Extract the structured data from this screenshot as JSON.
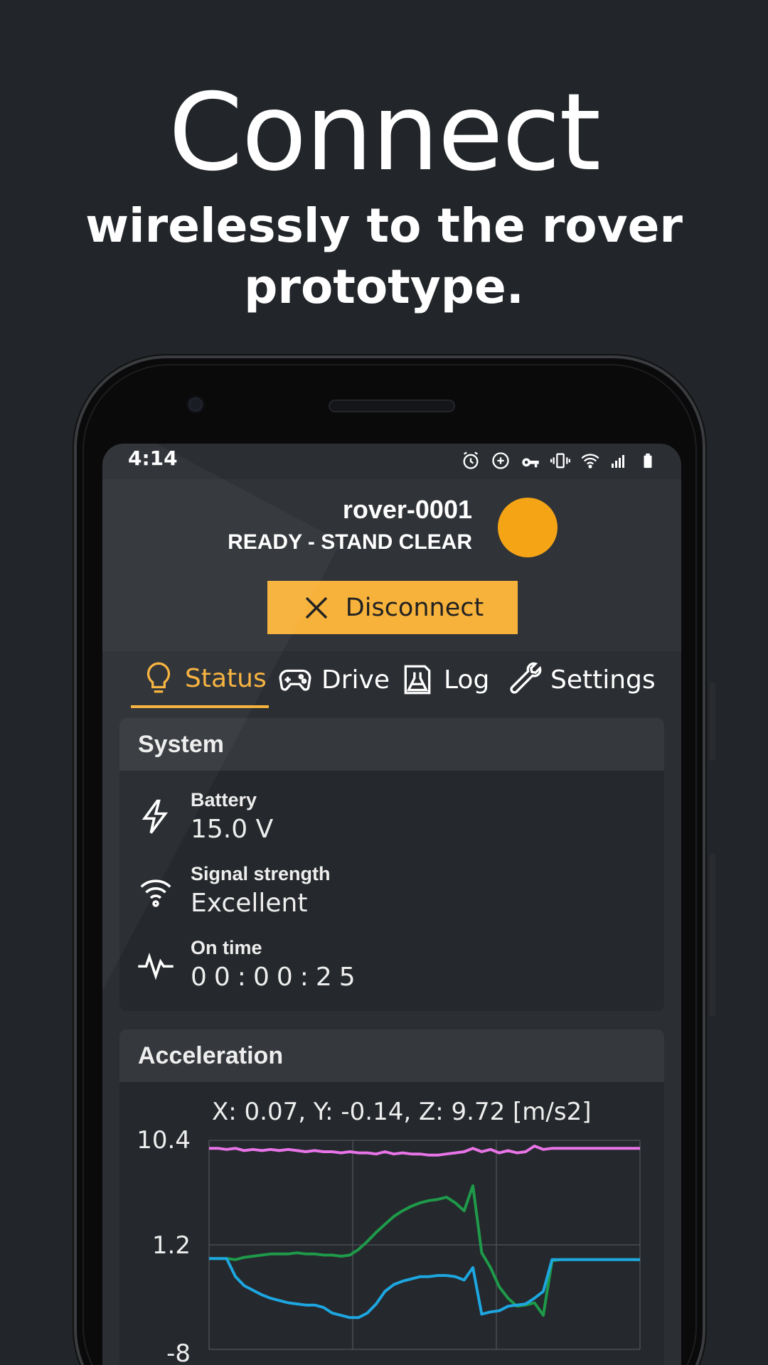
{
  "promo": {
    "title": "Connect",
    "subtitle_line1": "wirelessly to the rover",
    "subtitle_line2": "prototype."
  },
  "statusbar": {
    "time": "4:14",
    "icons": [
      "alarm-icon",
      "data-saver-icon",
      "vpn-key-icon",
      "vibrate-icon",
      "wifi-icon",
      "cell-signal-icon",
      "battery-icon"
    ]
  },
  "rover": {
    "name": "rover-0001",
    "state": "READY - STAND CLEAR",
    "indicator_color": "#f5a416"
  },
  "disconnect": {
    "label": "Disconnect",
    "icon": "close-icon",
    "color": "#f7b23b"
  },
  "tabs": [
    {
      "label": "Status",
      "icon": "lightbulb-icon",
      "active": true
    },
    {
      "label": "Drive",
      "icon": "gamepad-icon",
      "active": false
    },
    {
      "label": "Log",
      "icon": "flask-icon",
      "active": false
    },
    {
      "label": "Settings",
      "icon": "wrench-icon",
      "active": false
    }
  ],
  "system": {
    "title": "System",
    "rows": [
      {
        "label": "Battery",
        "value": "15.0 V",
        "icon": "lightning-icon"
      },
      {
        "label": "Signal strength",
        "value": "Excellent",
        "icon": "wifi-icon"
      },
      {
        "label": "On time",
        "value": "00:00:25",
        "icon": "pulse-icon"
      }
    ]
  },
  "acceleration": {
    "title": "Acceleration",
    "readout": "X: 0.07, Y: -0.14, Z: 9.72 [m/s2]"
  },
  "chart_data": {
    "type": "line",
    "title": "",
    "yticks": [
      "10.4",
      "1.2",
      "-8"
    ],
    "ylim": [
      -8,
      10.4
    ],
    "grid": true,
    "series": [
      {
        "color": "#e874e8",
        "values": [
          9.7,
          9.7,
          9.6,
          9.7,
          9.5,
          9.6,
          9.5,
          9.6,
          9.5,
          9.6,
          9.5,
          9.4,
          9.5,
          9.4,
          9.4,
          9.3,
          9.4,
          9.3,
          9.3,
          9.2,
          9.4,
          9.2,
          9.3,
          9.2,
          9.2,
          9.1,
          9.1,
          9.2,
          9.3,
          9.4,
          9.7,
          9.4,
          9.6,
          9.3,
          9.5,
          9.3,
          9.4,
          9.9,
          9.6,
          9.7,
          9.7,
          9.7,
          9.7,
          9.7,
          9.7,
          9.7,
          9.7,
          9.7,
          9.7,
          9.7
        ]
      },
      {
        "color": "#1e9a4a",
        "values": [
          0.0,
          0.0,
          0.0,
          -0.1,
          0.1,
          0.2,
          0.3,
          0.4,
          0.4,
          0.4,
          0.5,
          0.4,
          0.4,
          0.3,
          0.3,
          0.2,
          0.3,
          0.8,
          1.5,
          2.3,
          3.0,
          3.7,
          4.2,
          4.6,
          4.9,
          5.1,
          5.2,
          5.4,
          4.9,
          4.2,
          6.4,
          0.5,
          -0.8,
          -2.5,
          -3.5,
          -4.2,
          -4.1,
          -3.9,
          -5.0,
          -0.2,
          -0.1,
          -0.1,
          -0.1,
          -0.1,
          -0.1,
          -0.1,
          -0.1,
          -0.1,
          -0.1,
          -0.1
        ]
      },
      {
        "color": "#1da6e0",
        "values": [
          0.0,
          0.0,
          0.0,
          -1.6,
          -2.4,
          -2.8,
          -3.2,
          -3.5,
          -3.7,
          -3.9,
          -4.0,
          -4.1,
          -4.1,
          -4.3,
          -4.8,
          -5.0,
          -5.2,
          -5.2,
          -4.8,
          -4.0,
          -2.9,
          -2.3,
          -2.0,
          -1.8,
          -1.6,
          -1.6,
          -1.5,
          -1.5,
          -1.6,
          -1.9,
          -0.8,
          -4.9,
          -4.7,
          -4.6,
          -4.2,
          -4.1,
          -4.0,
          -3.5,
          -2.9,
          -0.1,
          -0.1,
          -0.1,
          -0.1,
          -0.1,
          -0.1,
          -0.1,
          -0.1,
          -0.1,
          -0.1,
          -0.1
        ]
      }
    ]
  }
}
